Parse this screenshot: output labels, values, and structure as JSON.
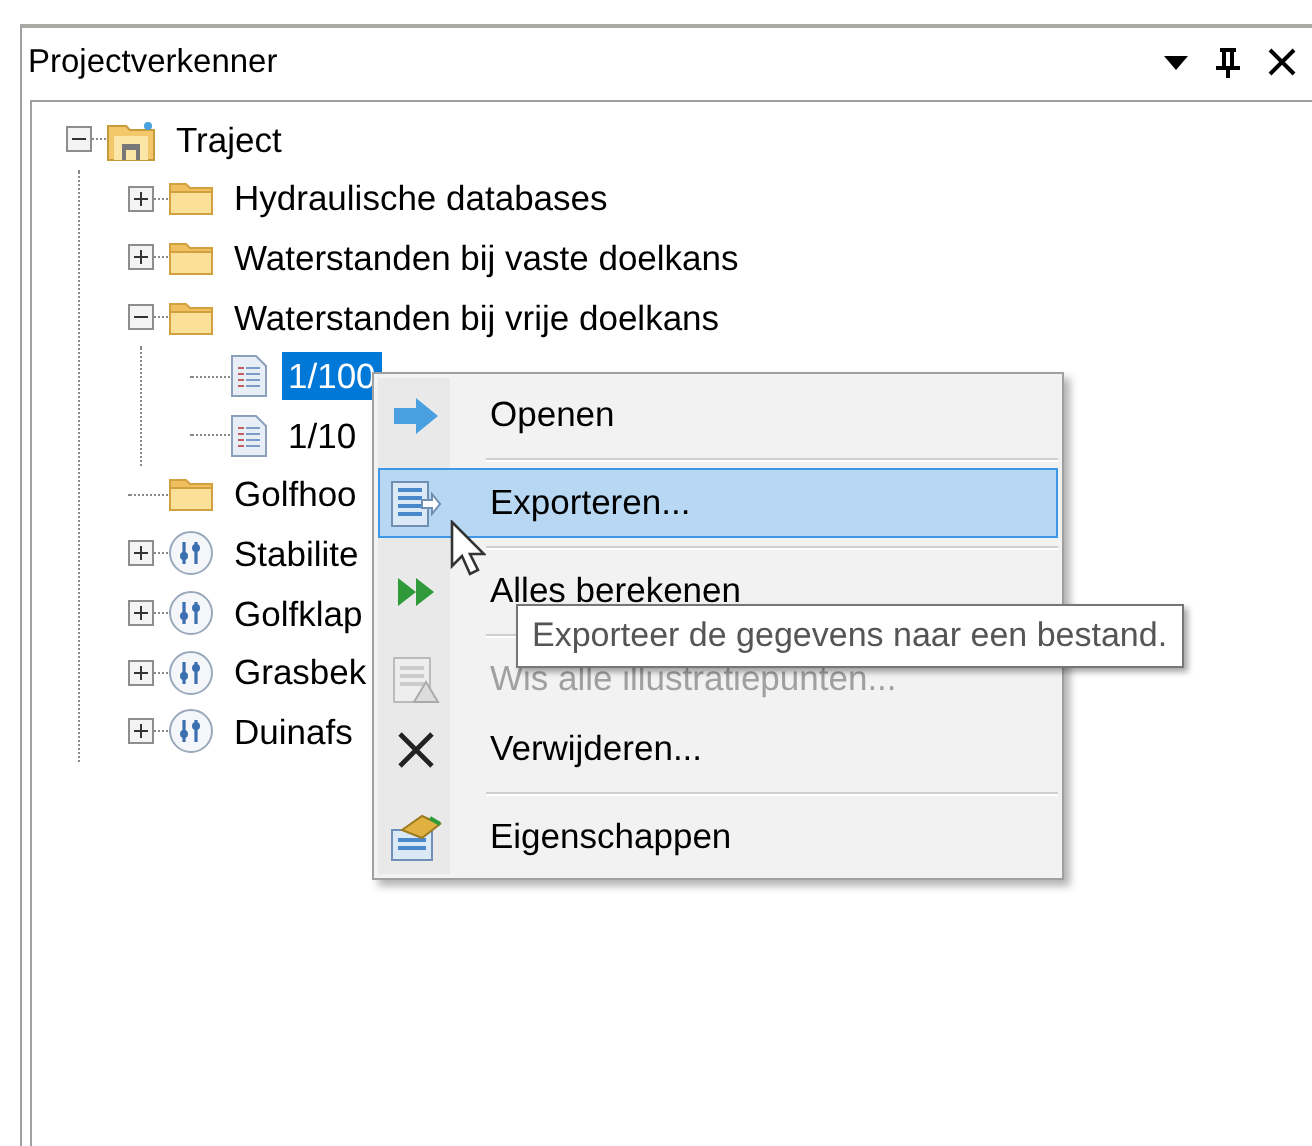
{
  "panel": {
    "title": "Projectverkenner"
  },
  "tree": [
    {
      "label": "Traject",
      "kind": "project",
      "expanded": true,
      "selected": false,
      "children": [
        {
          "label": "Hydraulische databases",
          "kind": "folder",
          "expanded": false,
          "selected": false
        },
        {
          "label": "Waterstanden bij vaste doelkans",
          "kind": "folder",
          "expanded": false,
          "selected": false
        },
        {
          "label": "Waterstanden bij vrije doelkans",
          "kind": "folder",
          "expanded": true,
          "selected": false,
          "children": [
            {
              "label": "1/100",
              "kind": "document",
              "selected": true
            },
            {
              "label": "1/10",
              "kind": "document",
              "selected": false
            }
          ]
        },
        {
          "label": "Golfhoo",
          "kind": "folder",
          "selected": false
        },
        {
          "label": "Stabilite",
          "kind": "calculation",
          "expanded": false,
          "selected": false
        },
        {
          "label": "Golfklap",
          "kind": "calculation",
          "expanded": false,
          "selected": false
        },
        {
          "label": "Grasbek",
          "kind": "calculation",
          "expanded": false,
          "selected": false
        },
        {
          "label": "Duinafs",
          "kind": "calculation",
          "expanded": false,
          "selected": false
        }
      ]
    }
  ],
  "context_menu": {
    "items": [
      {
        "kind": "open",
        "label": "Openen",
        "selected": false,
        "disabled": false
      },
      {
        "kind": "separator"
      },
      {
        "kind": "export",
        "label": "Exporteren...",
        "selected": true,
        "disabled": false
      },
      {
        "kind": "separator"
      },
      {
        "kind": "calculate",
        "label": "Alles berekenen",
        "selected": false,
        "disabled": false
      },
      {
        "kind": "separator"
      },
      {
        "kind": "clear",
        "label": "Wis alle illustratiepunten...",
        "selected": false,
        "disabled": true
      },
      {
        "kind": "delete",
        "label": "Verwijderen...",
        "selected": false,
        "disabled": false
      },
      {
        "kind": "separator"
      },
      {
        "kind": "properties",
        "label": "Eigenschappen",
        "selected": false,
        "disabled": false
      }
    ]
  },
  "tooltip": "Exporteer de gegevens naar een bestand."
}
